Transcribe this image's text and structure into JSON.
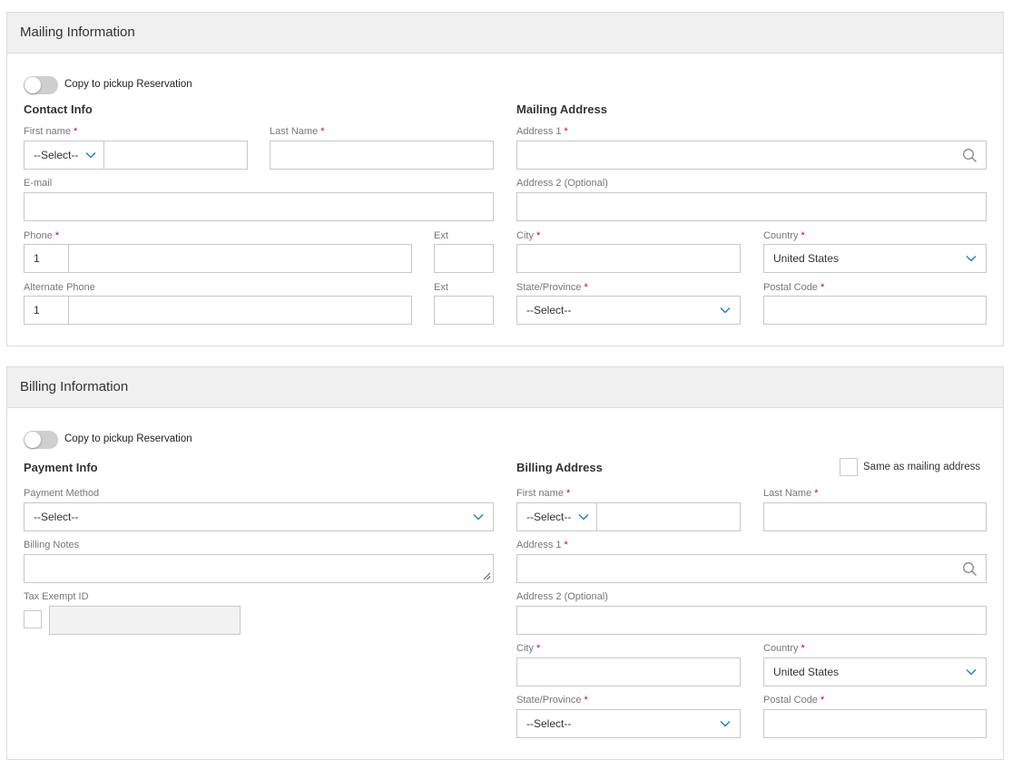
{
  "mailing": {
    "header": "Mailing Information",
    "toggle_label": "Copy to pickup Reservation",
    "contact_title": "Contact Info",
    "address_title": "Mailing Address",
    "first_name_label": "First name",
    "first_name_prefix": "--Select--",
    "last_name_label": "Last Name",
    "email_label": "E-mail",
    "phone_label": "Phone",
    "phone_code": "1",
    "ext_label": "Ext",
    "alt_phone_label": "Alternate Phone",
    "alt_phone_code": "1",
    "alt_ext_label": "Ext",
    "address1_label": "Address 1",
    "address2_label": "Address 2 (Optional)",
    "city_label": "City",
    "country_label": "Country",
    "country_value": "United States",
    "state_label": "State/Province",
    "state_value": "--Select--",
    "postal_label": "Postal Code",
    "required_mark": "*"
  },
  "billing": {
    "header": "Billing Information",
    "toggle_label": "Copy to pickup Reservation",
    "payment_title": "Payment Info",
    "address_title": "Billing Address",
    "same_as_label": "Same as mailing address",
    "payment_method_label": "Payment Method",
    "payment_method_value": "--Select--",
    "billing_notes_label": "Billing Notes",
    "tax_exempt_label": "Tax Exempt ID",
    "first_name_label": "First name",
    "first_name_prefix": "--Select--",
    "last_name_label": "Last Name",
    "address1_label": "Address 1",
    "address2_label": "Address 2 (Optional)",
    "city_label": "City",
    "country_label": "Country",
    "country_value": "United States",
    "state_label": "State/Province",
    "state_value": "--Select--",
    "postal_label": "Postal Code",
    "required_mark": "*"
  },
  "colors": {
    "accent_caret": "#1a7fc1",
    "required": "#d0021b",
    "header_bg": "#f0f0f0"
  },
  "icons": [
    "chevron-down-icon",
    "search-icon",
    "resize-handle-icon",
    "toggle-knob"
  ]
}
